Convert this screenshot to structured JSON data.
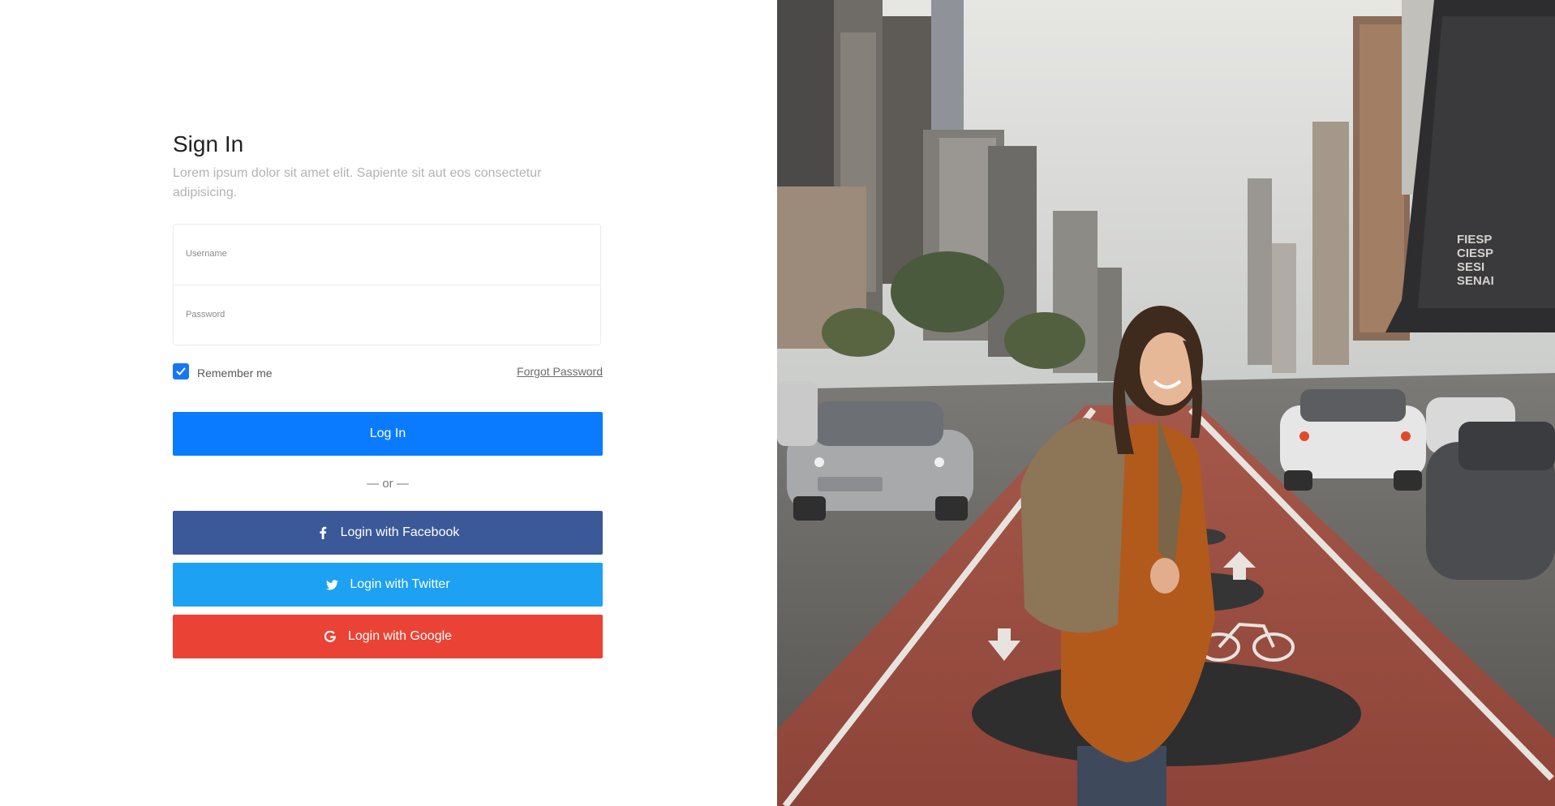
{
  "signin": {
    "title": "Sign In",
    "subtitle": "Lorem ipsum dolor sit amet elit. Sapiente sit aut eos consectetur adipisicing.",
    "username": {
      "label": "Username",
      "value": ""
    },
    "password": {
      "label": "Password",
      "value": ""
    },
    "remember": {
      "label": "Remember me",
      "checked": true
    },
    "forgot_label": "Forgot Password",
    "login_label": "Log In",
    "or_label": "— or —",
    "social": [
      {
        "label": "Login with Facebook",
        "icon": "facebook-icon",
        "color": "#3b5998"
      },
      {
        "label": "Login with Twitter",
        "icon": "twitter-icon",
        "color": "#1da1f2"
      },
      {
        "label": "Login with Google",
        "icon": "google-icon",
        "color": "#ea4335"
      }
    ]
  },
  "colors": {
    "primary": "#0a7bff",
    "checkbox": "#1976f2",
    "facebook": "#3b5998",
    "twitter": "#1da1f2",
    "google": "#ea4335"
  },
  "hero": {
    "sign_lines": [
      "FIESP",
      "CIESP",
      "SESI",
      "SENAI"
    ]
  }
}
